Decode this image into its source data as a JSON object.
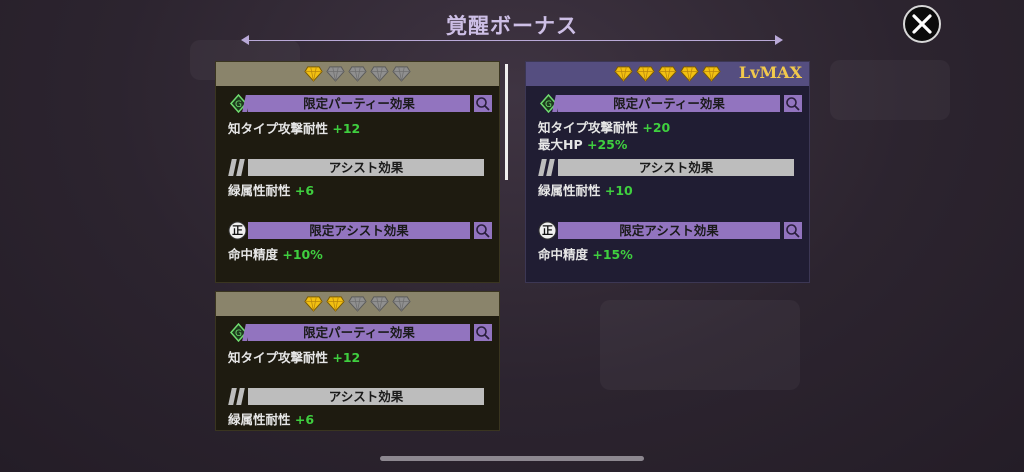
{
  "title": "覚醒ボーナス",
  "colors": {
    "gem_on": "#f2c012",
    "gem_off": "#8f8f8f",
    "value": "#3fcf3f",
    "lvmax": "#f2c94c"
  },
  "cards": [
    {
      "stars_filled": 1,
      "stars_total": 5,
      "level_label": "",
      "party": {
        "label": "限定パーティー効果",
        "lines": [
          {
            "name": "知タイプ攻撃耐性",
            "value": "+12"
          }
        ]
      },
      "assist": {
        "label": "アシスト効果",
        "lines": [
          {
            "name": "緑属性耐性",
            "value": "+6"
          }
        ]
      },
      "limited_assist": {
        "badge": "正",
        "label": "限定アシスト効果",
        "lines": [
          {
            "name": "命中精度",
            "value": "+10%"
          }
        ]
      }
    },
    {
      "stars_filled": 5,
      "stars_total": 5,
      "level_label": "LvMAX",
      "party": {
        "label": "限定パーティー効果",
        "lines": [
          {
            "name": "知タイプ攻撃耐性",
            "value": "+20"
          },
          {
            "name": "最大HP",
            "value": "+25%"
          }
        ]
      },
      "assist": {
        "label": "アシスト効果",
        "lines": [
          {
            "name": "緑属性耐性",
            "value": "+10"
          }
        ]
      },
      "limited_assist": {
        "badge": "正",
        "label": "限定アシスト効果",
        "lines": [
          {
            "name": "命中精度",
            "value": "+15%"
          }
        ]
      }
    },
    {
      "stars_filled": 2,
      "stars_total": 5,
      "level_label": "",
      "party": {
        "label": "限定パーティー効果",
        "lines": [
          {
            "name": "知タイプ攻撃耐性",
            "value": "+12"
          }
        ]
      },
      "assist": {
        "label": "アシスト効果",
        "lines": [
          {
            "name": "緑属性耐性",
            "value": "+6"
          }
        ]
      }
    }
  ]
}
